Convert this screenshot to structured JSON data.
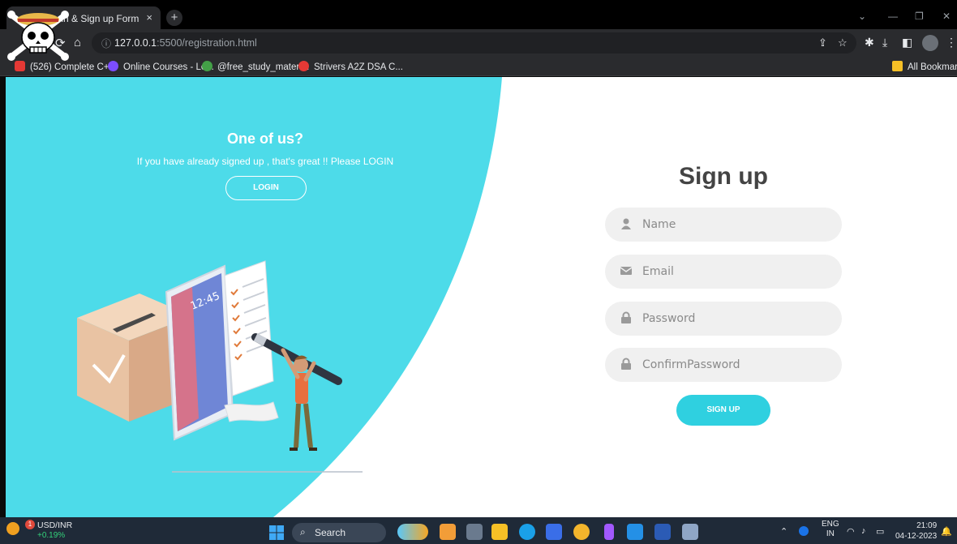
{
  "browser": {
    "tab_title": "Sign in & Sign up Form",
    "tab_close": "×",
    "new_tab": "+",
    "url_host": "127.0.0.1",
    "url_rest": ":5500/registration.html",
    "bookmarks": [
      {
        "label": "(526) Complete C+...",
        "color": "#e53935"
      },
      {
        "label": "Online Courses - Le...",
        "color": "#7c4dff"
      },
      {
        "label": "@free_study_materi...",
        "color": "#43a047"
      },
      {
        "label": "Strivers A2Z DSA C...",
        "color": "#e53935"
      }
    ],
    "all_bookmarks": "All Bookmarks"
  },
  "left_panel": {
    "title": "One of us?",
    "subtitle": "If you have already signed up , that's great !! Please LOGIN",
    "login_label": "LOGIN",
    "accent": "#4ddbe9"
  },
  "form": {
    "title": "Sign up",
    "fields": [
      {
        "placeholder": "Name",
        "icon": "user-icon"
      },
      {
        "placeholder": "Email",
        "icon": "envelope-icon"
      },
      {
        "placeholder": "Password",
        "icon": "lock-icon"
      },
      {
        "placeholder": "ConfirmPassword",
        "icon": "lock-icon"
      }
    ],
    "submit_label": "SIGN UP"
  },
  "taskbar": {
    "ticker": "USD/INR",
    "ticker_change": "+0.19%",
    "notification_count": "1",
    "search_label": "Search",
    "lang_line1": "ENG",
    "lang_line2": "IN",
    "time": "21:09",
    "date": "04-12-2023"
  }
}
